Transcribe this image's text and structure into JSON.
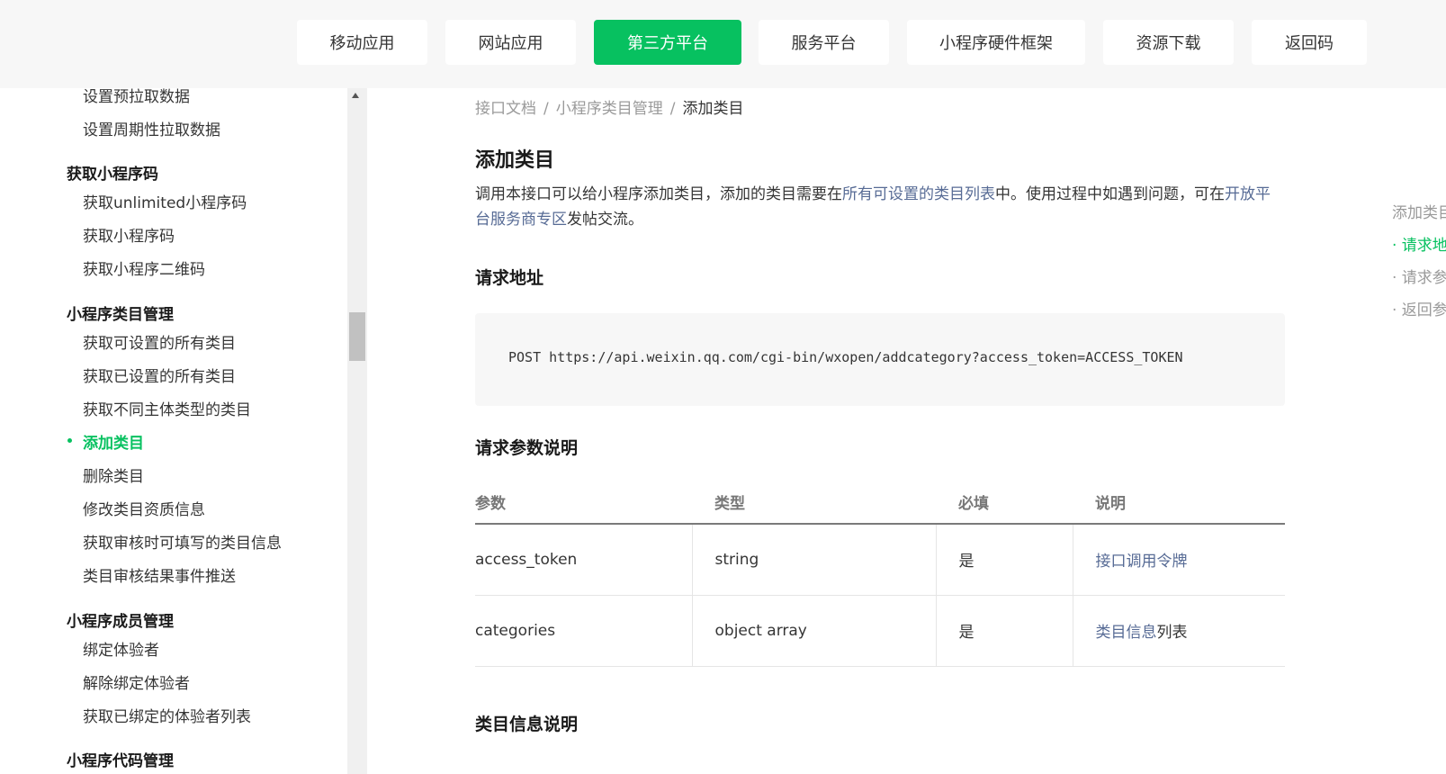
{
  "nav": {
    "tabs": [
      {
        "label": "移动应用"
      },
      {
        "label": "网站应用"
      },
      {
        "label": "第三方平台"
      },
      {
        "label": "服务平台"
      },
      {
        "label": "小程序硬件框架"
      },
      {
        "label": "资源下载"
      },
      {
        "label": "返回码"
      }
    ],
    "active_tab": "第三方平台"
  },
  "sidebar": {
    "items": [
      {
        "label": "设置预拉取数据"
      },
      {
        "label": "设置周期性拉取数据"
      },
      {
        "label": "获取小程序码"
      },
      {
        "label": "获取unlimited小程序码"
      },
      {
        "label": "获取小程序码"
      },
      {
        "label": "获取小程序二维码"
      },
      {
        "label": "小程序类目管理"
      },
      {
        "label": "获取可设置的所有类目"
      },
      {
        "label": "获取已设置的所有类目"
      },
      {
        "label": "获取不同主体类型的类目"
      },
      {
        "label": "添加类目"
      },
      {
        "label": "删除类目"
      },
      {
        "label": "修改类目资质信息"
      },
      {
        "label": "获取审核时可填写的类目信息"
      },
      {
        "label": "类目审核结果事件推送"
      },
      {
        "label": "小程序成员管理"
      },
      {
        "label": "绑定体验者"
      },
      {
        "label": "解除绑定体验者"
      },
      {
        "label": "获取已绑定的体验者列表"
      },
      {
        "label": "小程序代码管理"
      }
    ],
    "active_item": "添加类目"
  },
  "breadcrumb": {
    "items": [
      "接口文档",
      "小程序类目管理",
      "添加类目"
    ],
    "separator": "/"
  },
  "content": {
    "title": "添加类目",
    "intro_parts": [
      "调用本接口可以给小程序添加类目，添加的类目需要在",
      "所有可设置的类目列表",
      "中。使用过程中如遇到问题，可在",
      "开放平台服务商专区",
      "发帖交流。"
    ],
    "request_url_heading": "请求地址",
    "request_url": "POST https://api.weixin.qq.com/cgi-bin/wxopen/addcategory?access_token=ACCESS_TOKEN",
    "params_heading": "请求参数说明",
    "params_table": {
      "headers": [
        "参数",
        "类型",
        "必填",
        "说明"
      ],
      "rows": [
        {
          "param": "access_token",
          "type": "string",
          "required": "是",
          "desc": "接口调用令牌"
        },
        {
          "param": "categories",
          "type": "object array",
          "required": "是",
          "desc_link": "类目信息",
          "desc_rest": "列表"
        }
      ]
    },
    "category_info_heading": "类目信息说明"
  },
  "toc": {
    "items": [
      {
        "label": "添加类目"
      },
      {
        "label": "· 请求地址"
      },
      {
        "label": "· 请求参数说明"
      },
      {
        "label": "· 返回参数说明"
      }
    ]
  },
  "colors": {
    "accent": "#07c160",
    "link": "#576b95"
  }
}
